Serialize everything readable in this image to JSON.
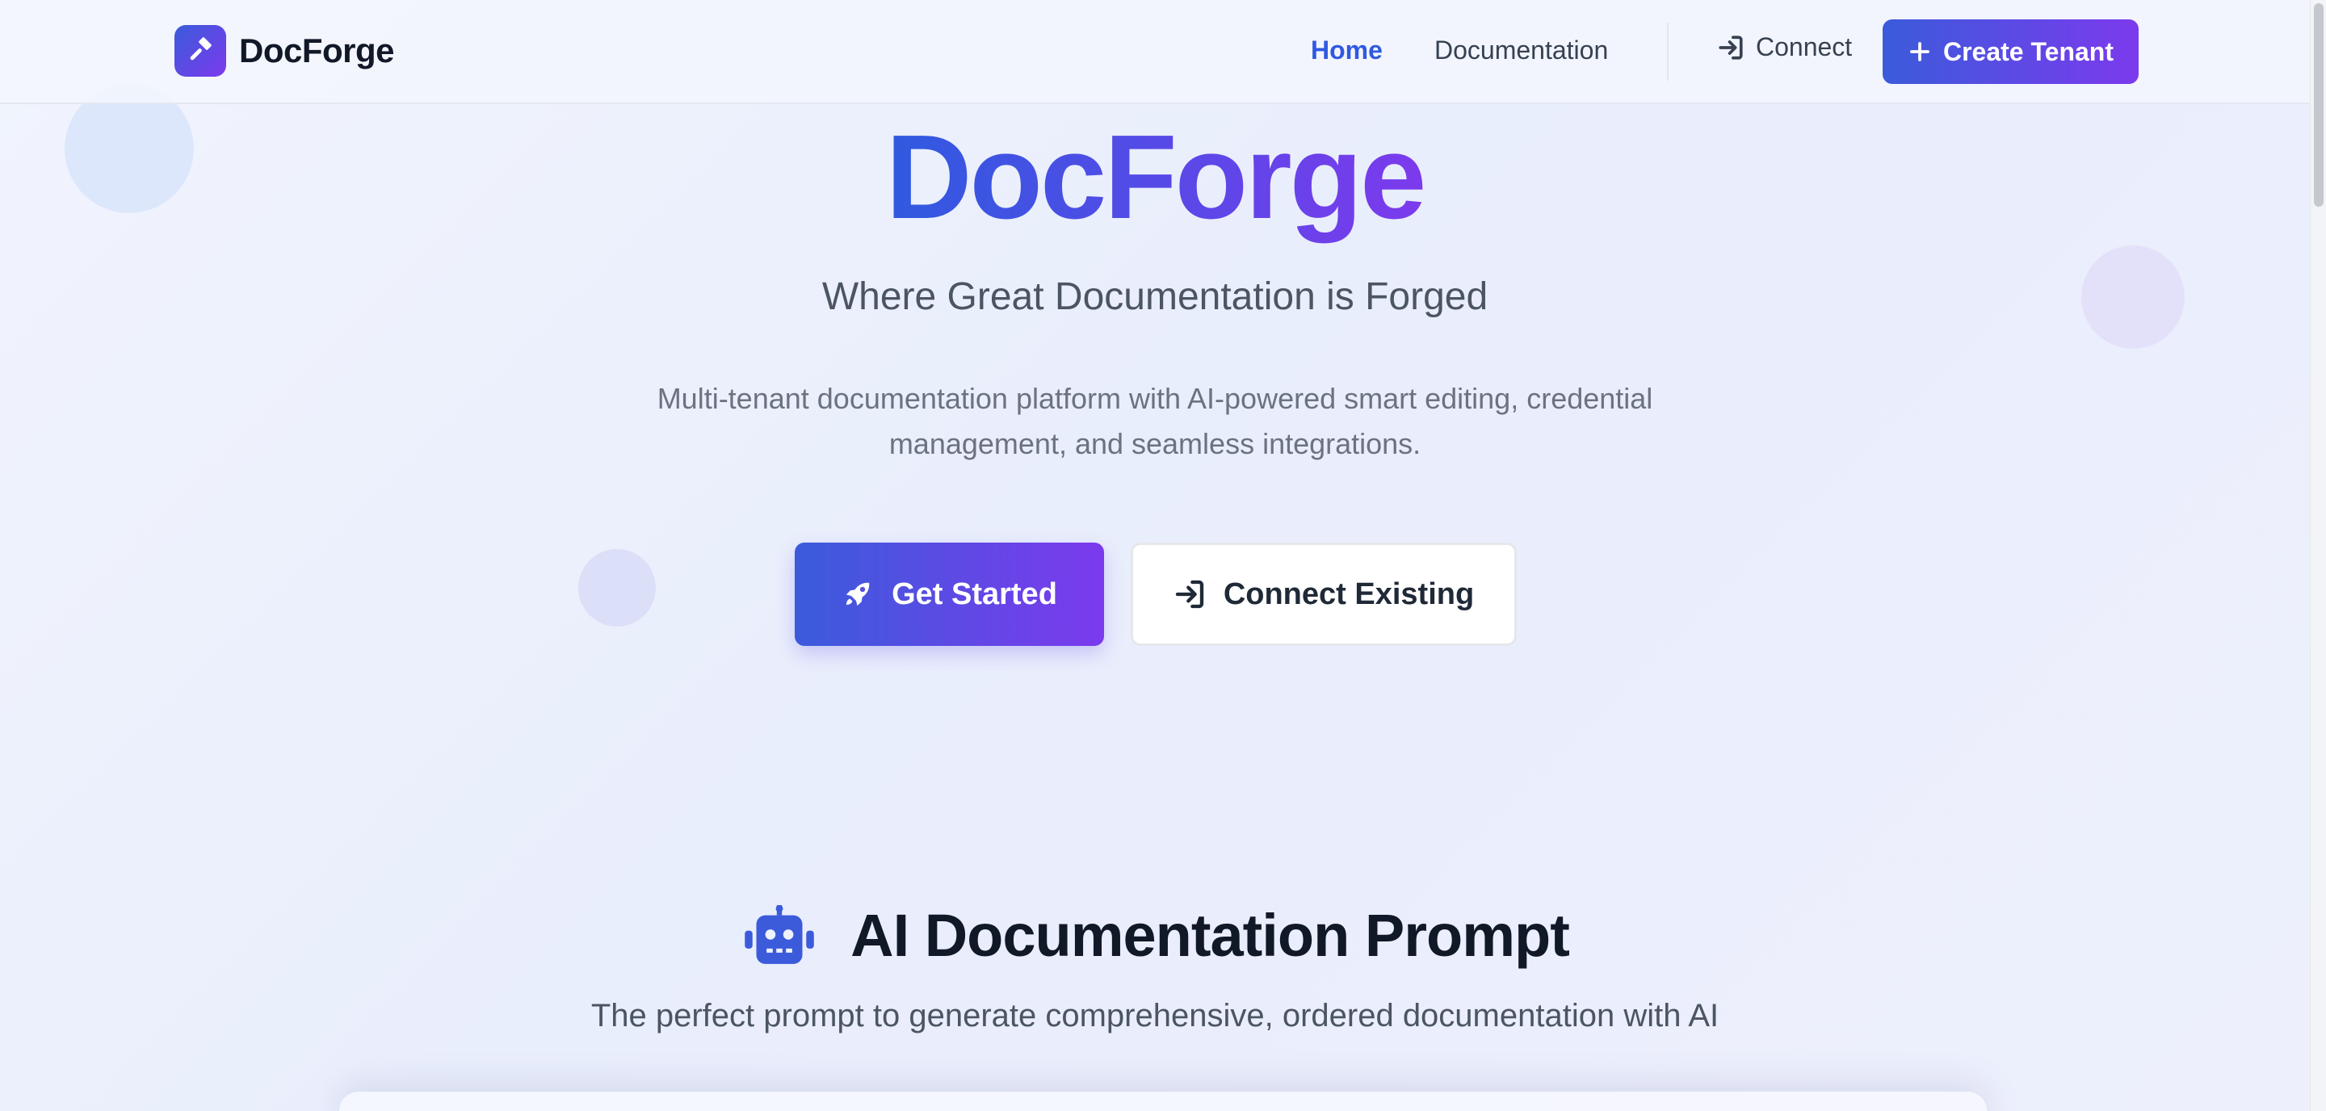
{
  "nav": {
    "brand": "DocForge",
    "links": [
      {
        "label": "Home",
        "active": true
      },
      {
        "label": "Documentation",
        "active": false
      }
    ],
    "connect_label": "Connect",
    "create_label": "Create Tenant"
  },
  "hero": {
    "title": "DocForge",
    "tagline": "Where Great Documentation is Forged",
    "description": "Multi-tenant documentation platform with AI-powered smart editing, credential management, and seamless integrations.",
    "primary_cta": "Get Started",
    "secondary_cta": "Connect Existing"
  },
  "ai_section": {
    "title": "AI Documentation Prompt",
    "subtitle": "The perfect prompt to generate comprehensive, ordered documentation with AI"
  },
  "icons": {
    "brand": "hammer-icon",
    "connect": "sign-in-icon",
    "create": "plus-icon",
    "get_started": "rocket-icon",
    "connect_existing": "sign-in-icon",
    "ai_section": "robot-icon"
  },
  "colors": {
    "accent_blue": "#2f5ae0",
    "accent_purple": "#7c3aed",
    "background": "#eef2fc"
  }
}
